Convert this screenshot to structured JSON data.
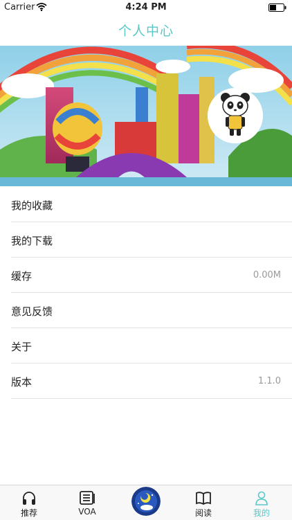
{
  "status_bar": {
    "carrier": "Carrier",
    "time": "4:24 PM"
  },
  "nav": {
    "title": "个人中心"
  },
  "menu": [
    {
      "label": "我的收藏",
      "value": ""
    },
    {
      "label": "我的下载",
      "value": ""
    },
    {
      "label": "缓存",
      "value": "0.00M"
    },
    {
      "label": "意见反馈",
      "value": ""
    },
    {
      "label": "关于",
      "value": ""
    },
    {
      "label": "版本",
      "value": "1.1.0"
    }
  ],
  "tabs": [
    {
      "label": "推荐",
      "icon": "headphones-icon"
    },
    {
      "label": "VOA",
      "icon": "news-icon"
    },
    {
      "label": "阅读",
      "icon": "book-icon"
    },
    {
      "label": "我的",
      "icon": "person-icon"
    }
  ],
  "colors": {
    "accent": "#5ac8c8",
    "tab_bar_bg": "#f8f8f8",
    "divider": "#e2e2e2"
  }
}
